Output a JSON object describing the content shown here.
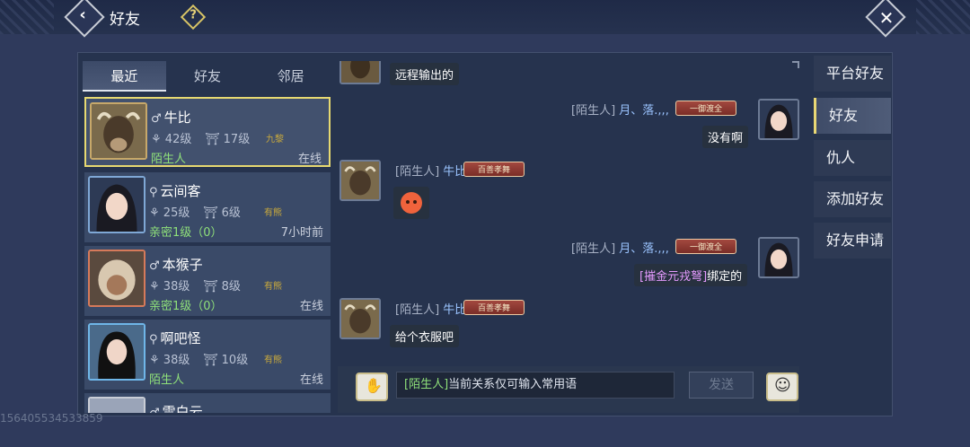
{
  "header": {
    "title": "好友",
    "help": "?",
    "close": "✕",
    "back": "‹"
  },
  "list": {
    "tabs": [
      {
        "label": "最近",
        "active": true
      },
      {
        "label": "好友",
        "active": false
      },
      {
        "label": "邻居",
        "active": false
      }
    ],
    "friends": [
      {
        "gender": "♂",
        "name": "牛比",
        "level": "42级",
        "home_level": "17级",
        "clan": "九黎",
        "relation": "陌生人",
        "status": "在线",
        "avatar": "bull"
      },
      {
        "gender": "⚲",
        "name": "云间客",
        "level": "25级",
        "home_level": "6级",
        "clan": "有熊",
        "relation": "亲密1级（0）",
        "status": "7小时前",
        "avatar": "girl"
      },
      {
        "gender": "♂",
        "name": "本猴子",
        "level": "38级",
        "home_level": "8级",
        "clan": "有熊",
        "relation": "亲密1级（0）",
        "status": "在线",
        "avatar": "monkey"
      },
      {
        "gender": "⚲",
        "name": "啊吧怪",
        "level": "38级",
        "home_level": "10级",
        "clan": "有熊",
        "relation": "陌生人",
        "status": "在线",
        "avatar": "woman"
      },
      {
        "gender": "♂",
        "name": "雪白云",
        "level": "",
        "home_level": "",
        "clan": "",
        "relation": "",
        "status": "",
        "avatar": "white"
      }
    ]
  },
  "chat": {
    "messages": [
      {
        "text": "远程输出的"
      },
      {
        "prefix": "[陌生人]",
        "name": "月、落.,,,",
        "badge": "一御渡全",
        "text": "没有啊"
      },
      {
        "prefix": "[陌生人]",
        "name": "牛比",
        "badge": "百善孝舞",
        "emoji": "sad-face"
      },
      {
        "prefix": "[陌生人]",
        "name": "月、落.,,,",
        "badge": "一御渡全",
        "item": "[摧金元戎弩]",
        "text": "绑定的"
      },
      {
        "prefix": "[陌生人]",
        "name": "牛比",
        "badge": "百善孝舞",
        "text": "给个衣服吧"
      }
    ],
    "input": {
      "tag": "[陌生人]",
      "placeholder": "当前关系仅可输入常用语"
    },
    "send_label": "发送"
  },
  "nav": [
    {
      "label": "平台好友",
      "active": false
    },
    {
      "label": "好友",
      "active": true
    },
    {
      "label": "仇人",
      "active": false
    },
    {
      "label": "添加好友",
      "active": false
    },
    {
      "label": "好友申请",
      "active": false
    }
  ],
  "watermark": "156405534533859"
}
